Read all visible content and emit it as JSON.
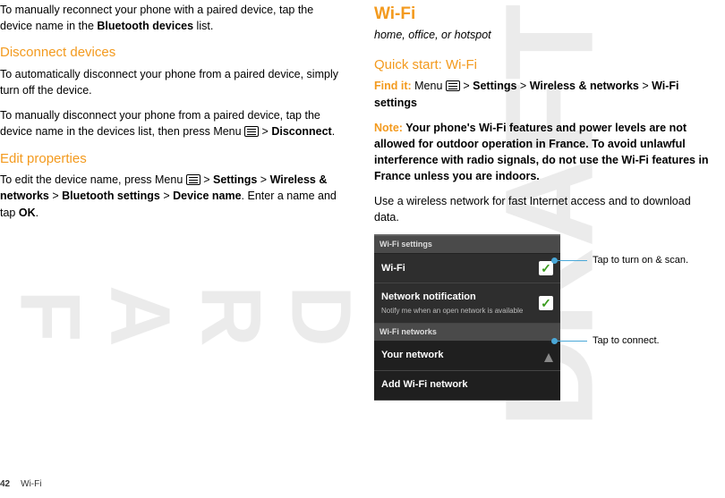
{
  "watermark": "DRAFT",
  "left": {
    "p1a": "To manually reconnect your phone with a paired device, tap the device name in the ",
    "p1b": "Bluetooth devices",
    "p1c": " list.",
    "h_disconnect": "Disconnect devices",
    "p2": "To automatically disconnect your phone from a paired device, simply turn off the device.",
    "p3a": "To manually disconnect your phone from a paired device, tap the device name in the devices list, then press Menu ",
    "p3b": " > ",
    "p3c": "Disconnect",
    "p3d": ".",
    "h_edit": "Edit properties",
    "p4a": "To edit the device name, press Menu ",
    "p4b": " > ",
    "p4c": "Settings",
    "p4d": " > ",
    "p4e": "Wireless & networks",
    "p4f": " > ",
    "p4g": "Bluetooth settings",
    "p4h": " > ",
    "p4i": "Device name",
    "p4j": ". Enter a name and tap ",
    "p4k": "OK",
    "p4l": "."
  },
  "right": {
    "title": "Wi-Fi",
    "subtitle": "home, office, or hotspot",
    "quick": "Quick start: Wi-Fi",
    "find_lead": "Find it:",
    "find_a": " Menu ",
    "find_b": " > ",
    "find_c": "Settings",
    "find_d": " > ",
    "find_e": "Wireless & networks",
    "find_f": " > ",
    "find_g": "Wi-Fi settings",
    "note_lead": "Note:",
    "note_body": " Your phone's Wi-Fi features and power levels are not allowed for outdoor operation in France. To avoid unlawful interference with radio signals, do not use the Wi-Fi features in France unless you are indoors.",
    "p_use": "Use a wireless network for fast Internet access and to download data."
  },
  "phone": {
    "header1": "Wi-Fi settings",
    "row_wifi": "Wi-Fi",
    "row_notif_title": "Network notification",
    "row_notif_sub": "Notify me when an open network is available",
    "header2": "Wi-Fi networks",
    "row_your": "Your network",
    "row_add": "Add Wi-Fi network",
    "check": "✓"
  },
  "callouts": {
    "c1": "Tap to turn on & scan.",
    "c2": "Tap to connect."
  },
  "footer": {
    "page": "42",
    "section": "Wi-Fi"
  }
}
